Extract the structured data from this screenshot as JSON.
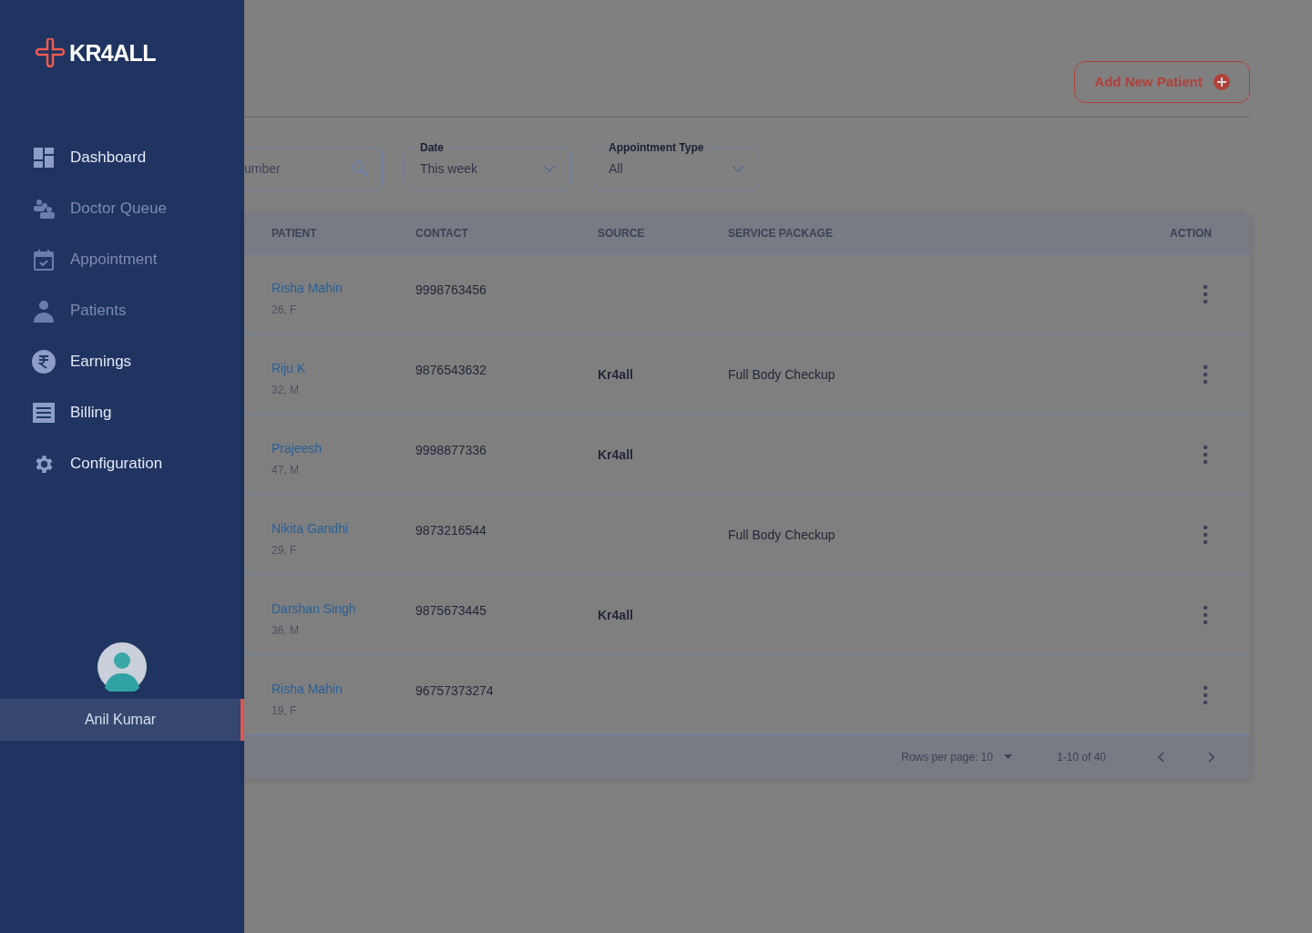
{
  "brand": {
    "name": "KR4ALL"
  },
  "nav": [
    {
      "label": "Dashboard",
      "kind": "dashboard",
      "disabled": false
    },
    {
      "label": "Doctor Queue",
      "kind": "queue",
      "disabled": true
    },
    {
      "label": "Appointment",
      "kind": "calendar",
      "disabled": true
    },
    {
      "label": "Patients",
      "kind": "patient",
      "disabled": true
    },
    {
      "label": "Earnings",
      "kind": "rupee",
      "disabled": false
    },
    {
      "label": "Billing",
      "kind": "receipt",
      "disabled": false
    },
    {
      "label": "Configuration",
      "kind": "gear",
      "disabled": false
    }
  ],
  "user": {
    "name": "Anil Kumar",
    "selected": true
  },
  "add_button": {
    "label": "Add New Patient"
  },
  "filters": {
    "search": {
      "placeholder": "umber"
    },
    "date": {
      "label": "Date",
      "value": "This week"
    },
    "appointment_type": {
      "label": "Appointment Type",
      "value": "All"
    }
  },
  "table": {
    "columns": [
      "PATIENT",
      "CONTACT",
      "SOURCE",
      "SERVICE PACKAGE",
      "ACTION"
    ],
    "rows": [
      {
        "name": "Risha Mahin",
        "info": "26, F",
        "contact": "9998763456"
      },
      {
        "name": "Riju K",
        "info": "32, M",
        "contact": "9876543632",
        "source": "Kr4all",
        "package": "Full Body Checkup"
      },
      {
        "name": "Prajeesh",
        "info": "47, M",
        "contact": "9998877336",
        "source": "Kr4all"
      },
      {
        "name": "Nikita Gandhi",
        "info": "29, F",
        "contact": "9873216544",
        "package": "Full Body Checkup"
      },
      {
        "name": "Darshan Singh",
        "info": "36, M",
        "contact": "9875673445",
        "source": "Kr4all"
      },
      {
        "name": "Risha Mahin",
        "info": "19, F",
        "contact": "96757373274"
      }
    ]
  },
  "pagination": {
    "rows_per_page": "Rows per page: 10",
    "range": "1-10 of 40"
  }
}
